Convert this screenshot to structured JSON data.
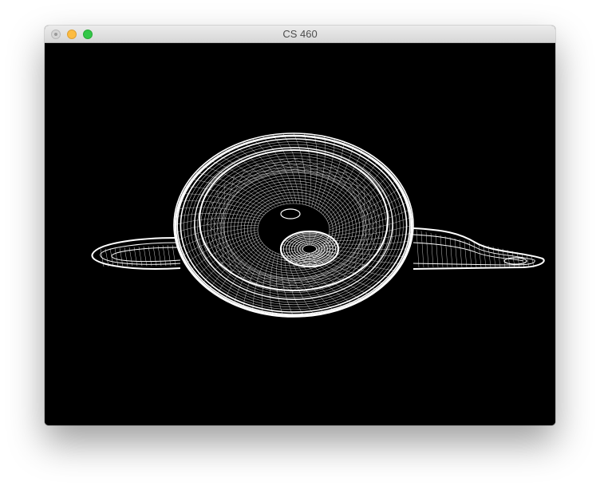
{
  "window": {
    "title": "CS 460"
  },
  "viewport": {
    "background_color": "#000000",
    "wire_color": "#ffffff",
    "render_mode": "wireframe",
    "object": "teapot"
  },
  "icons": {
    "close": "close-icon",
    "minimize": "minimize-icon",
    "zoom": "zoom-icon"
  },
  "colors": {
    "close": "#d6d6d6",
    "minimize": "#fdbc40",
    "zoom": "#33c748"
  }
}
